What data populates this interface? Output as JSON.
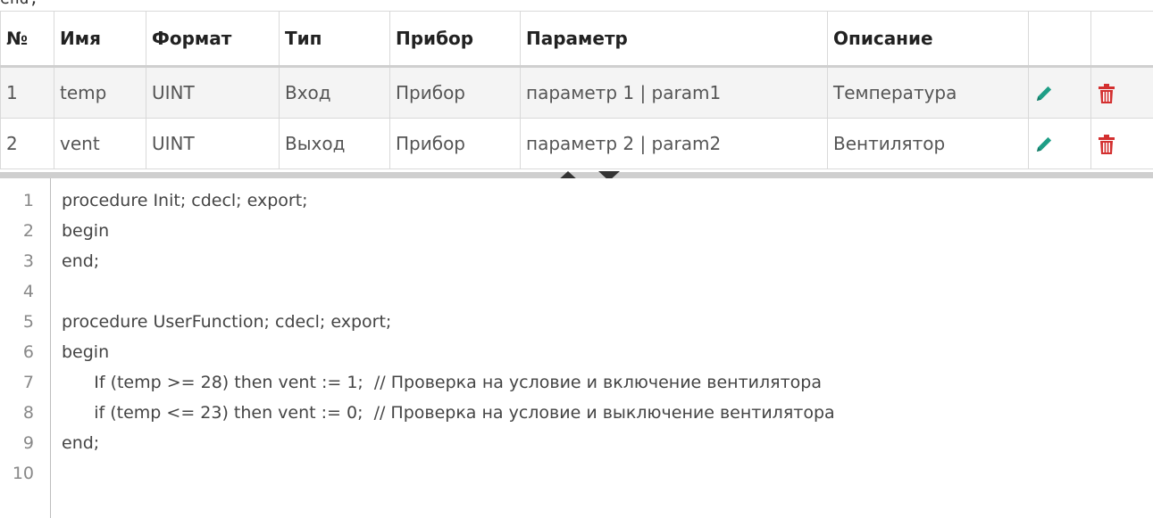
{
  "top_clip_text": "end;",
  "table": {
    "headers": [
      "№",
      "Имя",
      "Формат",
      "Тип",
      "Прибор",
      "Параметр",
      "Описание",
      "",
      ""
    ],
    "rows": [
      {
        "num": "1",
        "name": "temp",
        "format": "UINT",
        "type": "Вход",
        "device": "Прибор",
        "param": "параметр 1 | param1",
        "desc": "Температура"
      },
      {
        "num": "2",
        "name": "vent",
        "format": "UINT",
        "type": "Выход",
        "device": "Прибор",
        "param": "параметр 2 | param2",
        "desc": "Вентилятор"
      }
    ]
  },
  "colors": {
    "edit_icon": "#1e9e86",
    "delete_icon": "#d32f2f"
  },
  "icons": {
    "edit": "pencil-icon",
    "delete": "trash-icon",
    "split_up": "arrow-up-icon",
    "split_down": "arrow-down-icon"
  },
  "code": {
    "lines": [
      {
        "n": "1",
        "text": "procedure Init; cdecl; export;"
      },
      {
        "n": "2",
        "text": "begin"
      },
      {
        "n": "3",
        "text": "end;"
      },
      {
        "n": "4",
        "text": ""
      },
      {
        "n": "5",
        "text": "procedure UserFunction; cdecl; export;"
      },
      {
        "n": "6",
        "text": "begin"
      },
      {
        "n": "7",
        "text": "      If (temp >= 28) then vent := 1;  // Проверка на условие и включение вентилятора"
      },
      {
        "n": "8",
        "text": "      if (temp <= 23) then vent := 0;  // Проверка на условие и выключение вентилятора"
      },
      {
        "n": "9",
        "text": "end;"
      },
      {
        "n": "10",
        "text": ""
      }
    ]
  }
}
